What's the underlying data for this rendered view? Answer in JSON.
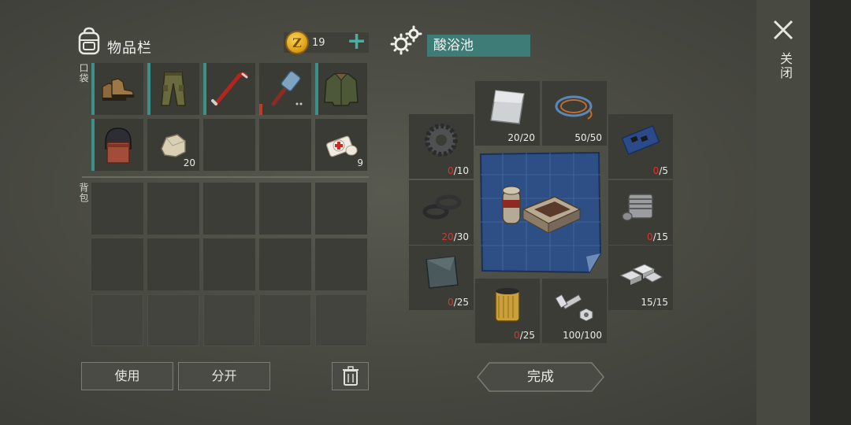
{
  "inventory": {
    "title": "物品栏",
    "coins": "19",
    "coin_symbol": "Z",
    "pocket_label": "口袋",
    "backpack_label": "背包",
    "pocket_slots": [
      {
        "item": "boots-icon",
        "count": ""
      },
      {
        "item": "pants-icon",
        "count": ""
      },
      {
        "item": "crowbar-icon",
        "count": ""
      },
      {
        "item": "hammer-icon",
        "count": ""
      },
      {
        "item": "jacket-icon",
        "count": ""
      },
      {
        "item": "helmet-icon",
        "count": ""
      },
      {
        "item": "stone-icon",
        "count": "20"
      },
      {
        "item": "",
        "count": ""
      },
      {
        "item": "",
        "count": ""
      },
      {
        "item": "bandage-icon",
        "count": "9"
      }
    ]
  },
  "buttons": {
    "use": "使用",
    "split": "分开",
    "trash_icon": "trash-icon"
  },
  "crafting": {
    "station_name": "酸浴池",
    "complete": "完成",
    "materials": {
      "sheet_metal": {
        "have": "20",
        "need": "/20"
      },
      "wires": {
        "have": "50",
        "need": "/50"
      },
      "gear": {
        "have": "0",
        "need": "/10"
      },
      "circuit": {
        "have": "0",
        "need": "/5"
      },
      "rubber_parts": {
        "have": "20",
        "need": "/30"
      },
      "engine_part": {
        "have": "0",
        "need": "/15"
      },
      "glass": {
        "have": "0",
        "need": "/25"
      },
      "aluminum": {
        "have": "15",
        "need": "/15"
      },
      "filter": {
        "have": "0",
        "need": "/25"
      },
      "bolts": {
        "have": "100",
        "need": "/100"
      }
    }
  },
  "close": {
    "label": "关闭"
  },
  "colors": {
    "accent": "#3e7c77",
    "missing": "#d9362b",
    "plus": "#45b0a5"
  }
}
